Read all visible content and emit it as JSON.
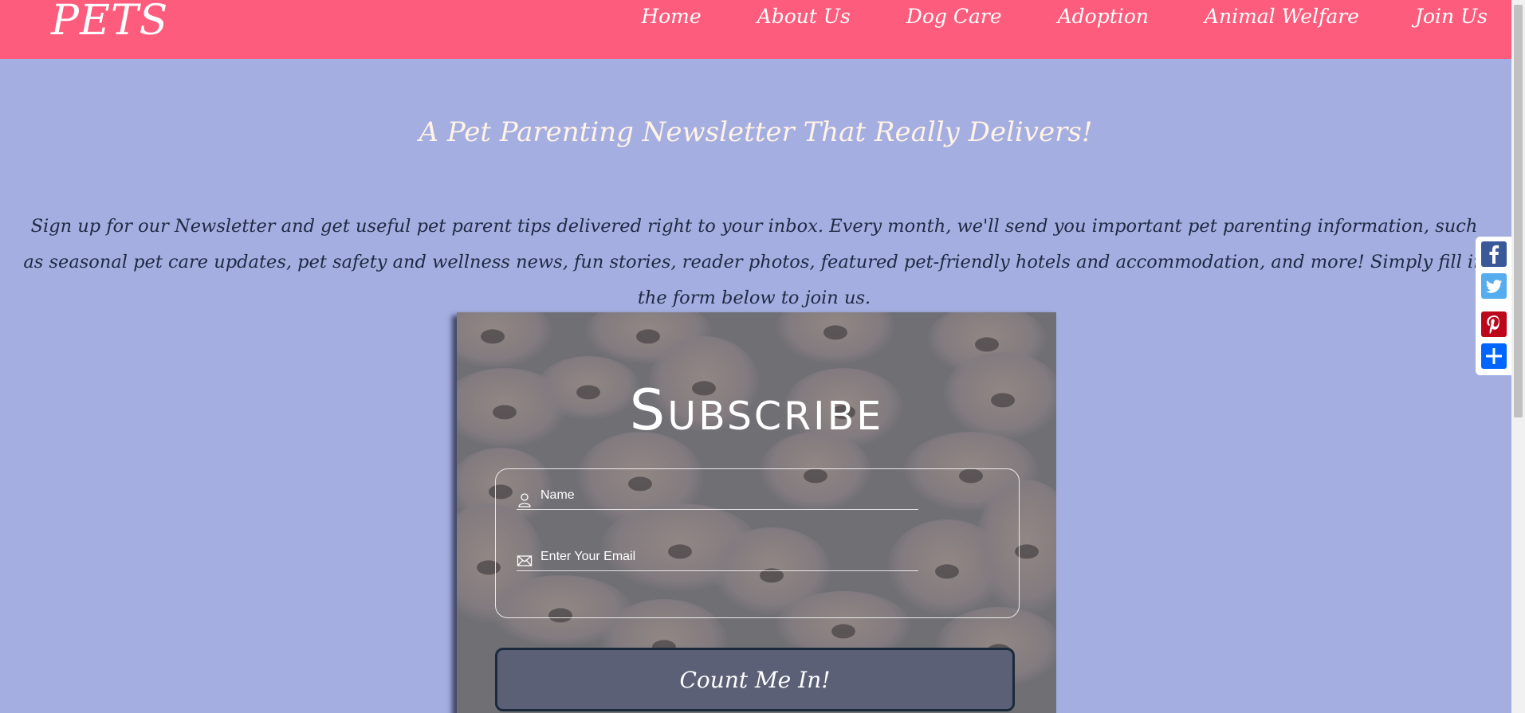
{
  "header": {
    "logo": "PETS",
    "nav": [
      "Home",
      "About Us",
      "Dog Care",
      "Adoption",
      "Animal Welfare",
      "Join Us"
    ]
  },
  "hero": {
    "headline": "A Pet Parenting Newsletter That Really Delivers!",
    "intro": "Sign up for our Newsletter and get useful pet parent tips delivered right to your inbox. Every month, we'll send you important pet parenting information, such as seasonal pet care updates, pet safety and wellness news, fun stories, reader photos, featured pet-friendly hotels and accommodation, and more! Simply fill in the form below to join us."
  },
  "subscribe": {
    "title": "Subscribe",
    "name_placeholder": "Name",
    "email_placeholder": "Enter Your Email",
    "button_label": "Count Me In!"
  },
  "share": {
    "items": [
      "facebook-icon",
      "twitter-icon",
      "pinterest-icon",
      "share-plus-icon"
    ],
    "colors": {
      "facebook": "#3b5998",
      "twitter": "#55acee",
      "pinterest": "#bd081c",
      "share": "#0166ff"
    }
  },
  "theme": {
    "header_bg": "#fe5c7c",
    "page_bg": "#a5aee0",
    "headline_color": "#fff3e6",
    "intro_color": "#1e2a44",
    "button_bg": "#5c6077"
  }
}
